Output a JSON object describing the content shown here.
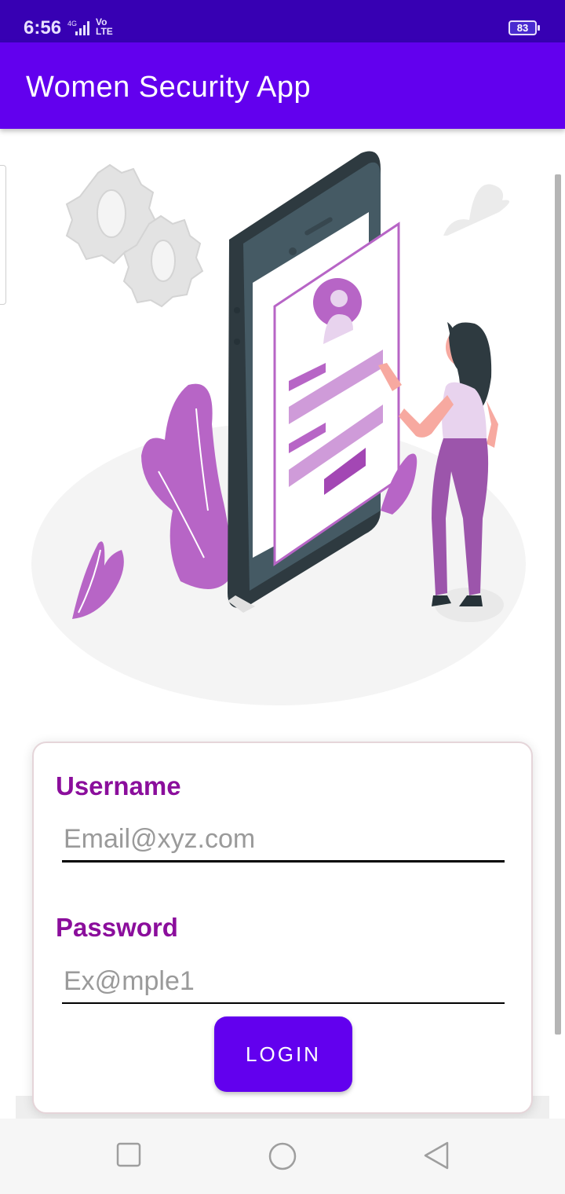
{
  "status_bar": {
    "time": "6:56",
    "network": "4G",
    "volte_top": "Vo",
    "volte_bottom": "LTE",
    "battery": "83"
  },
  "app_bar": {
    "title": "Women Security App"
  },
  "illustration": {
    "icon": "login-illustration-icon"
  },
  "login_form": {
    "username_label": "Username",
    "username_placeholder": "Email@xyz.com",
    "username_value": "",
    "password_label": "Password",
    "password_placeholder": "Ex@mple1",
    "password_value": "",
    "login_button": "LOGIN"
  },
  "colors": {
    "primary": "#6200EE",
    "primary_dark": "#3700B3",
    "label": "#8B0E9C",
    "illustration_accent": "#B765C6"
  },
  "nav_bar": {
    "recent_icon": "square-icon",
    "home_icon": "circle-icon",
    "back_icon": "triangle-back-icon"
  }
}
